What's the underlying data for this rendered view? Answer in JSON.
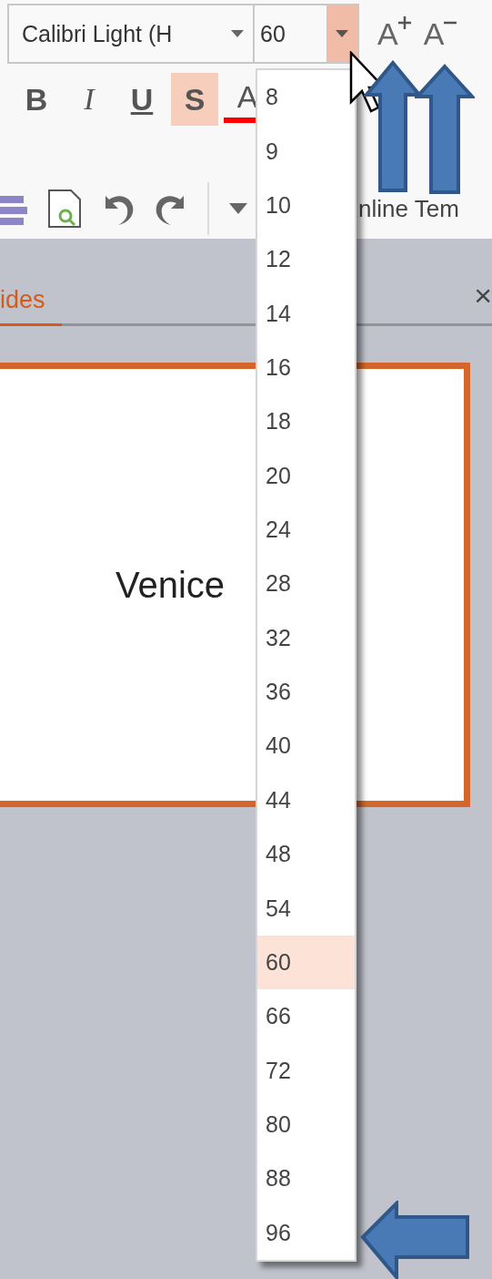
{
  "toolbar": {
    "font_name": "Calibri Light (H",
    "font_size": "60",
    "size_button_pressed": true,
    "grow_shrink": [
      {
        "kind": "grow",
        "label": "A"
      },
      {
        "kind": "shrink",
        "label": "A"
      }
    ],
    "format_buttons": [
      {
        "kind": "bold",
        "label": "B",
        "selected": false
      },
      {
        "kind": "italic",
        "label": "I",
        "selected": false
      },
      {
        "kind": "underline",
        "label": "U",
        "selected": false
      },
      {
        "kind": "shadow",
        "label": "S",
        "selected": true
      },
      {
        "kind": "font-color",
        "label": "A",
        "selected": false
      }
    ],
    "quick_access_text": "nline Tem"
  },
  "tabs": [
    {
      "label": "ides",
      "selected": true
    }
  ],
  "close": "×",
  "slide": {
    "title": "Venice"
  },
  "size_dropdown": [
    {
      "label": "8",
      "selected": false
    },
    {
      "label": "9",
      "selected": false
    },
    {
      "label": "10",
      "selected": false
    },
    {
      "label": "12",
      "selected": false
    },
    {
      "label": "14",
      "selected": false
    },
    {
      "label": "16",
      "selected": false
    },
    {
      "label": "18",
      "selected": false
    },
    {
      "label": "20",
      "selected": false
    },
    {
      "label": "24",
      "selected": false
    },
    {
      "label": "28",
      "selected": false
    },
    {
      "label": "32",
      "selected": false
    },
    {
      "label": "36",
      "selected": false
    },
    {
      "label": "40",
      "selected": false
    },
    {
      "label": "44",
      "selected": false
    },
    {
      "label": "48",
      "selected": false
    },
    {
      "label": "54",
      "selected": false
    },
    {
      "label": "60",
      "selected": true
    },
    {
      "label": "66",
      "selected": false
    },
    {
      "label": "72",
      "selected": false
    },
    {
      "label": "80",
      "selected": false
    },
    {
      "label": "88",
      "selected": false
    },
    {
      "label": "96",
      "selected": false
    }
  ]
}
